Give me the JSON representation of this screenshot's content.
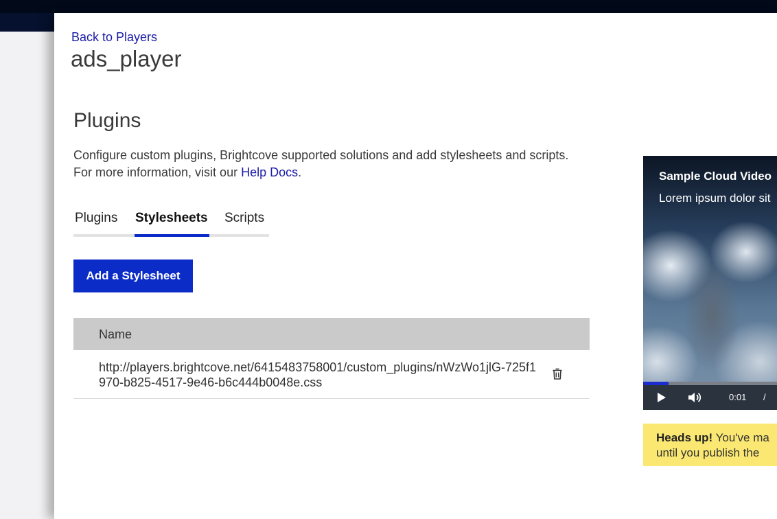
{
  "header": {
    "back_link": "Back to Players",
    "player_name": "ads_player"
  },
  "section": {
    "title": "Plugins",
    "description_line1": "Configure custom plugins, Brightcove supported solutions and add stylesheets and scripts.",
    "description_line2_prefix": "For more information, visit our ",
    "help_link": "Help Docs",
    "description_line2_suffix": "."
  },
  "tabs": [
    {
      "label": "Plugins",
      "active": false
    },
    {
      "label": "Stylesheets",
      "active": true
    },
    {
      "label": "Scripts",
      "active": false
    }
  ],
  "add_button": "Add a Stylesheet",
  "table": {
    "header": "Name",
    "rows": [
      {
        "name": "http://players.brightcove.net/6415483758001/custom_plugins/nWzWo1jlG-725f1970-b825-4517-9e46-b6c444b0048e.css"
      }
    ]
  },
  "player_preview": {
    "title": "Sample Cloud Video",
    "description": "Lorem ipsum dolor sit",
    "current_time": "0:01",
    "time_separator": "/",
    "progress_fraction": 0.19
  },
  "alert": {
    "heading": "Heads up!",
    "line1": " You've ma",
    "line2": "until you publish the"
  },
  "colors": {
    "accent": "#0b2cc7",
    "link": "#1a1aa6",
    "alert_bg": "#fbe873",
    "topbar": "#020a1a"
  }
}
